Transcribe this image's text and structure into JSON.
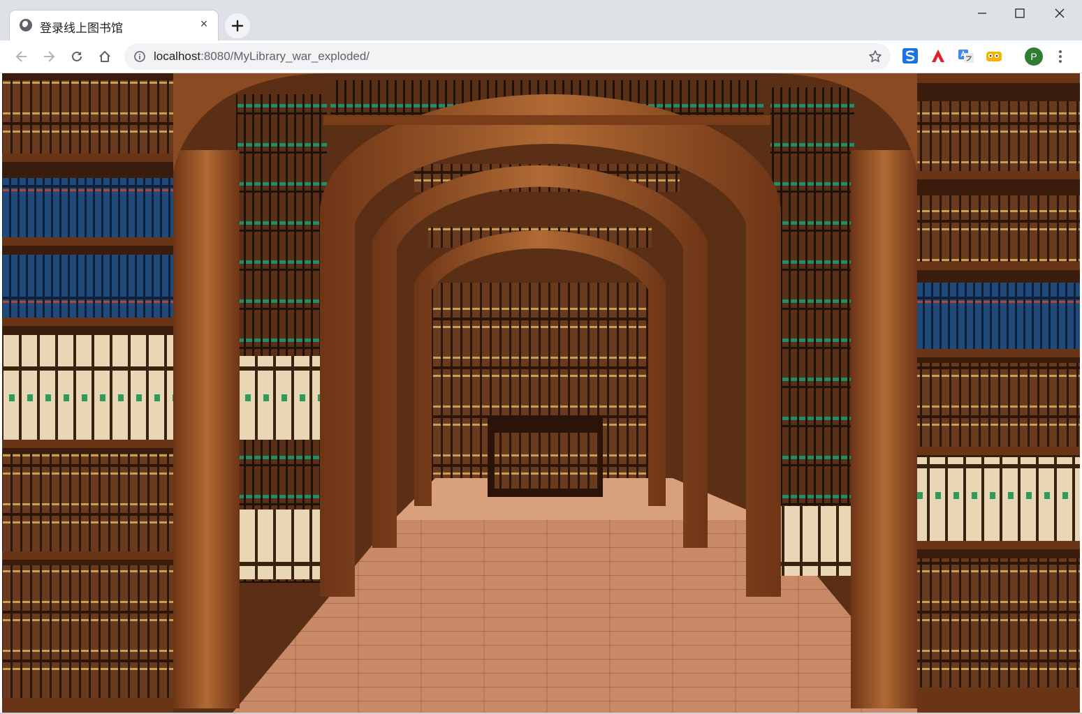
{
  "browser": {
    "tab": {
      "title": "登录线上图书馆",
      "close_glyph": "×"
    },
    "new_tab_label": "+",
    "address": {
      "host": "localhost",
      "path": ":8080/MyLibrary_war_exploded/"
    },
    "profile_initial": "P",
    "icons": {
      "back": "arrow-left-icon",
      "forward": "arrow-right-icon",
      "reload": "reload-icon",
      "home": "home-icon",
      "site_info": "info-icon",
      "bookmark": "star-icon",
      "menu": "kebab-menu-icon",
      "minimize": "minimize-icon",
      "maximize": "maximize-icon",
      "close": "close-icon"
    },
    "extensions": [
      "sogou-s-extension-icon",
      "adobe-acrobat-extension-icon",
      "google-translate-extension-icon",
      "tampermonkey-extension-icon"
    ],
    "colors": {
      "tabstrip": "#dee1e6",
      "toolbar": "#ffffff",
      "omnibox": "#f1f3f4",
      "profile": "#2e7d32"
    }
  },
  "page": {
    "background_image": "library-arches-bookshelves",
    "colors": {
      "wood": "#8a4a22",
      "shelf_dark": "#3a1c0c",
      "floor": "#c88a66"
    }
  }
}
